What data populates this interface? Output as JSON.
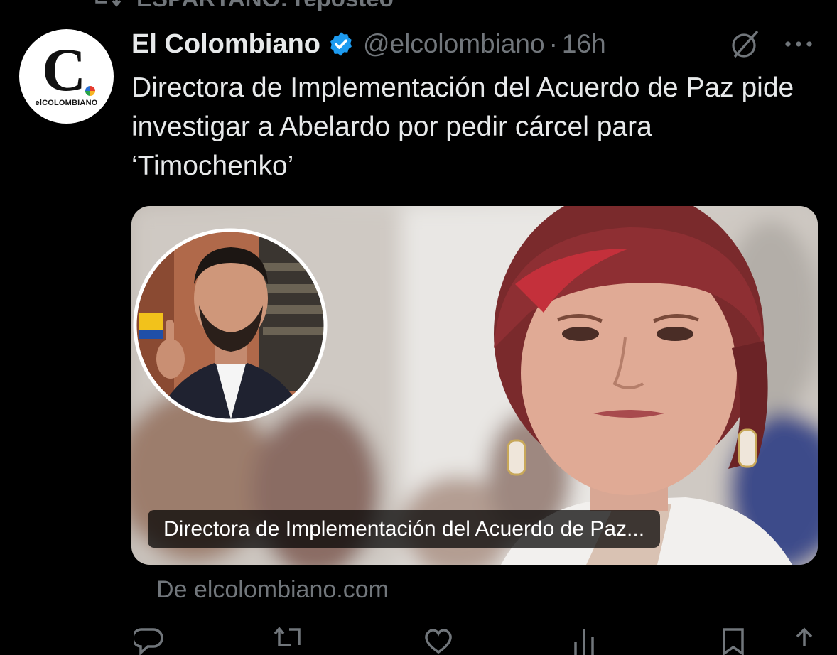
{
  "repost_banner": {
    "text": "ESPARTANO: reposteó"
  },
  "tweet": {
    "author_name": "El Colombiano",
    "handle": "@elcolombiano",
    "separator": "·",
    "time": "16h",
    "text": "Directora de Implementación del Acuerdo de Paz pide investigar a Abelardo por pedir cárcel para ‘Timochenko’"
  },
  "avatar": {
    "logo_letter": "C",
    "logo_word": "elCOLOMBIANO"
  },
  "link_card": {
    "caption": "Directora de Implementación del Acuerdo de Paz...",
    "source": "De elcolombiano.com"
  },
  "actions": {
    "reply_count": "",
    "repost_count": "",
    "like_count": "",
    "views_count": ""
  },
  "colors": {
    "background": "#000000",
    "text_primary": "#e7e9ea",
    "text_secondary": "#71767b",
    "verified_badge": "#1d9bf0"
  },
  "icons": [
    "repost-icon",
    "verified-badge-icon",
    "grok-icon",
    "more-icon",
    "reply-icon",
    "like-icon",
    "views-icon",
    "bookmark-icon"
  ]
}
